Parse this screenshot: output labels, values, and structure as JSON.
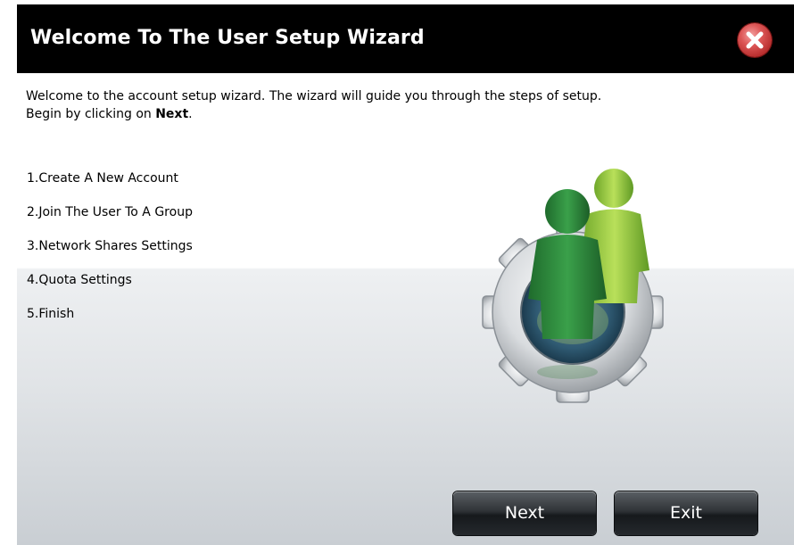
{
  "dialog": {
    "title": "Welcome To The User Setup Wizard",
    "close_icon": "close-x-icon",
    "intro_line1": "Welcome to the account setup wizard. The wizard will guide you through the steps of setup.",
    "intro_line2_prefix": "Begin by clicking on ",
    "intro_line2_bold": "Next",
    "intro_line2_suffix": ".",
    "steps": [
      "1.Create A New Account",
      "2.Join The User To A Group",
      "3.Network Shares Settings",
      "4.Quota Settings",
      "5.Finish"
    ],
    "illustration_icon": "users-gear-icon",
    "buttons": {
      "next_label": "Next",
      "exit_label": "Exit"
    }
  },
  "colors": {
    "titlebar": "#000000",
    "close_button": "#c43c3c",
    "user_front": "#2e7d32",
    "user_back": "#8bc34a",
    "gear": "#d8dadc"
  }
}
